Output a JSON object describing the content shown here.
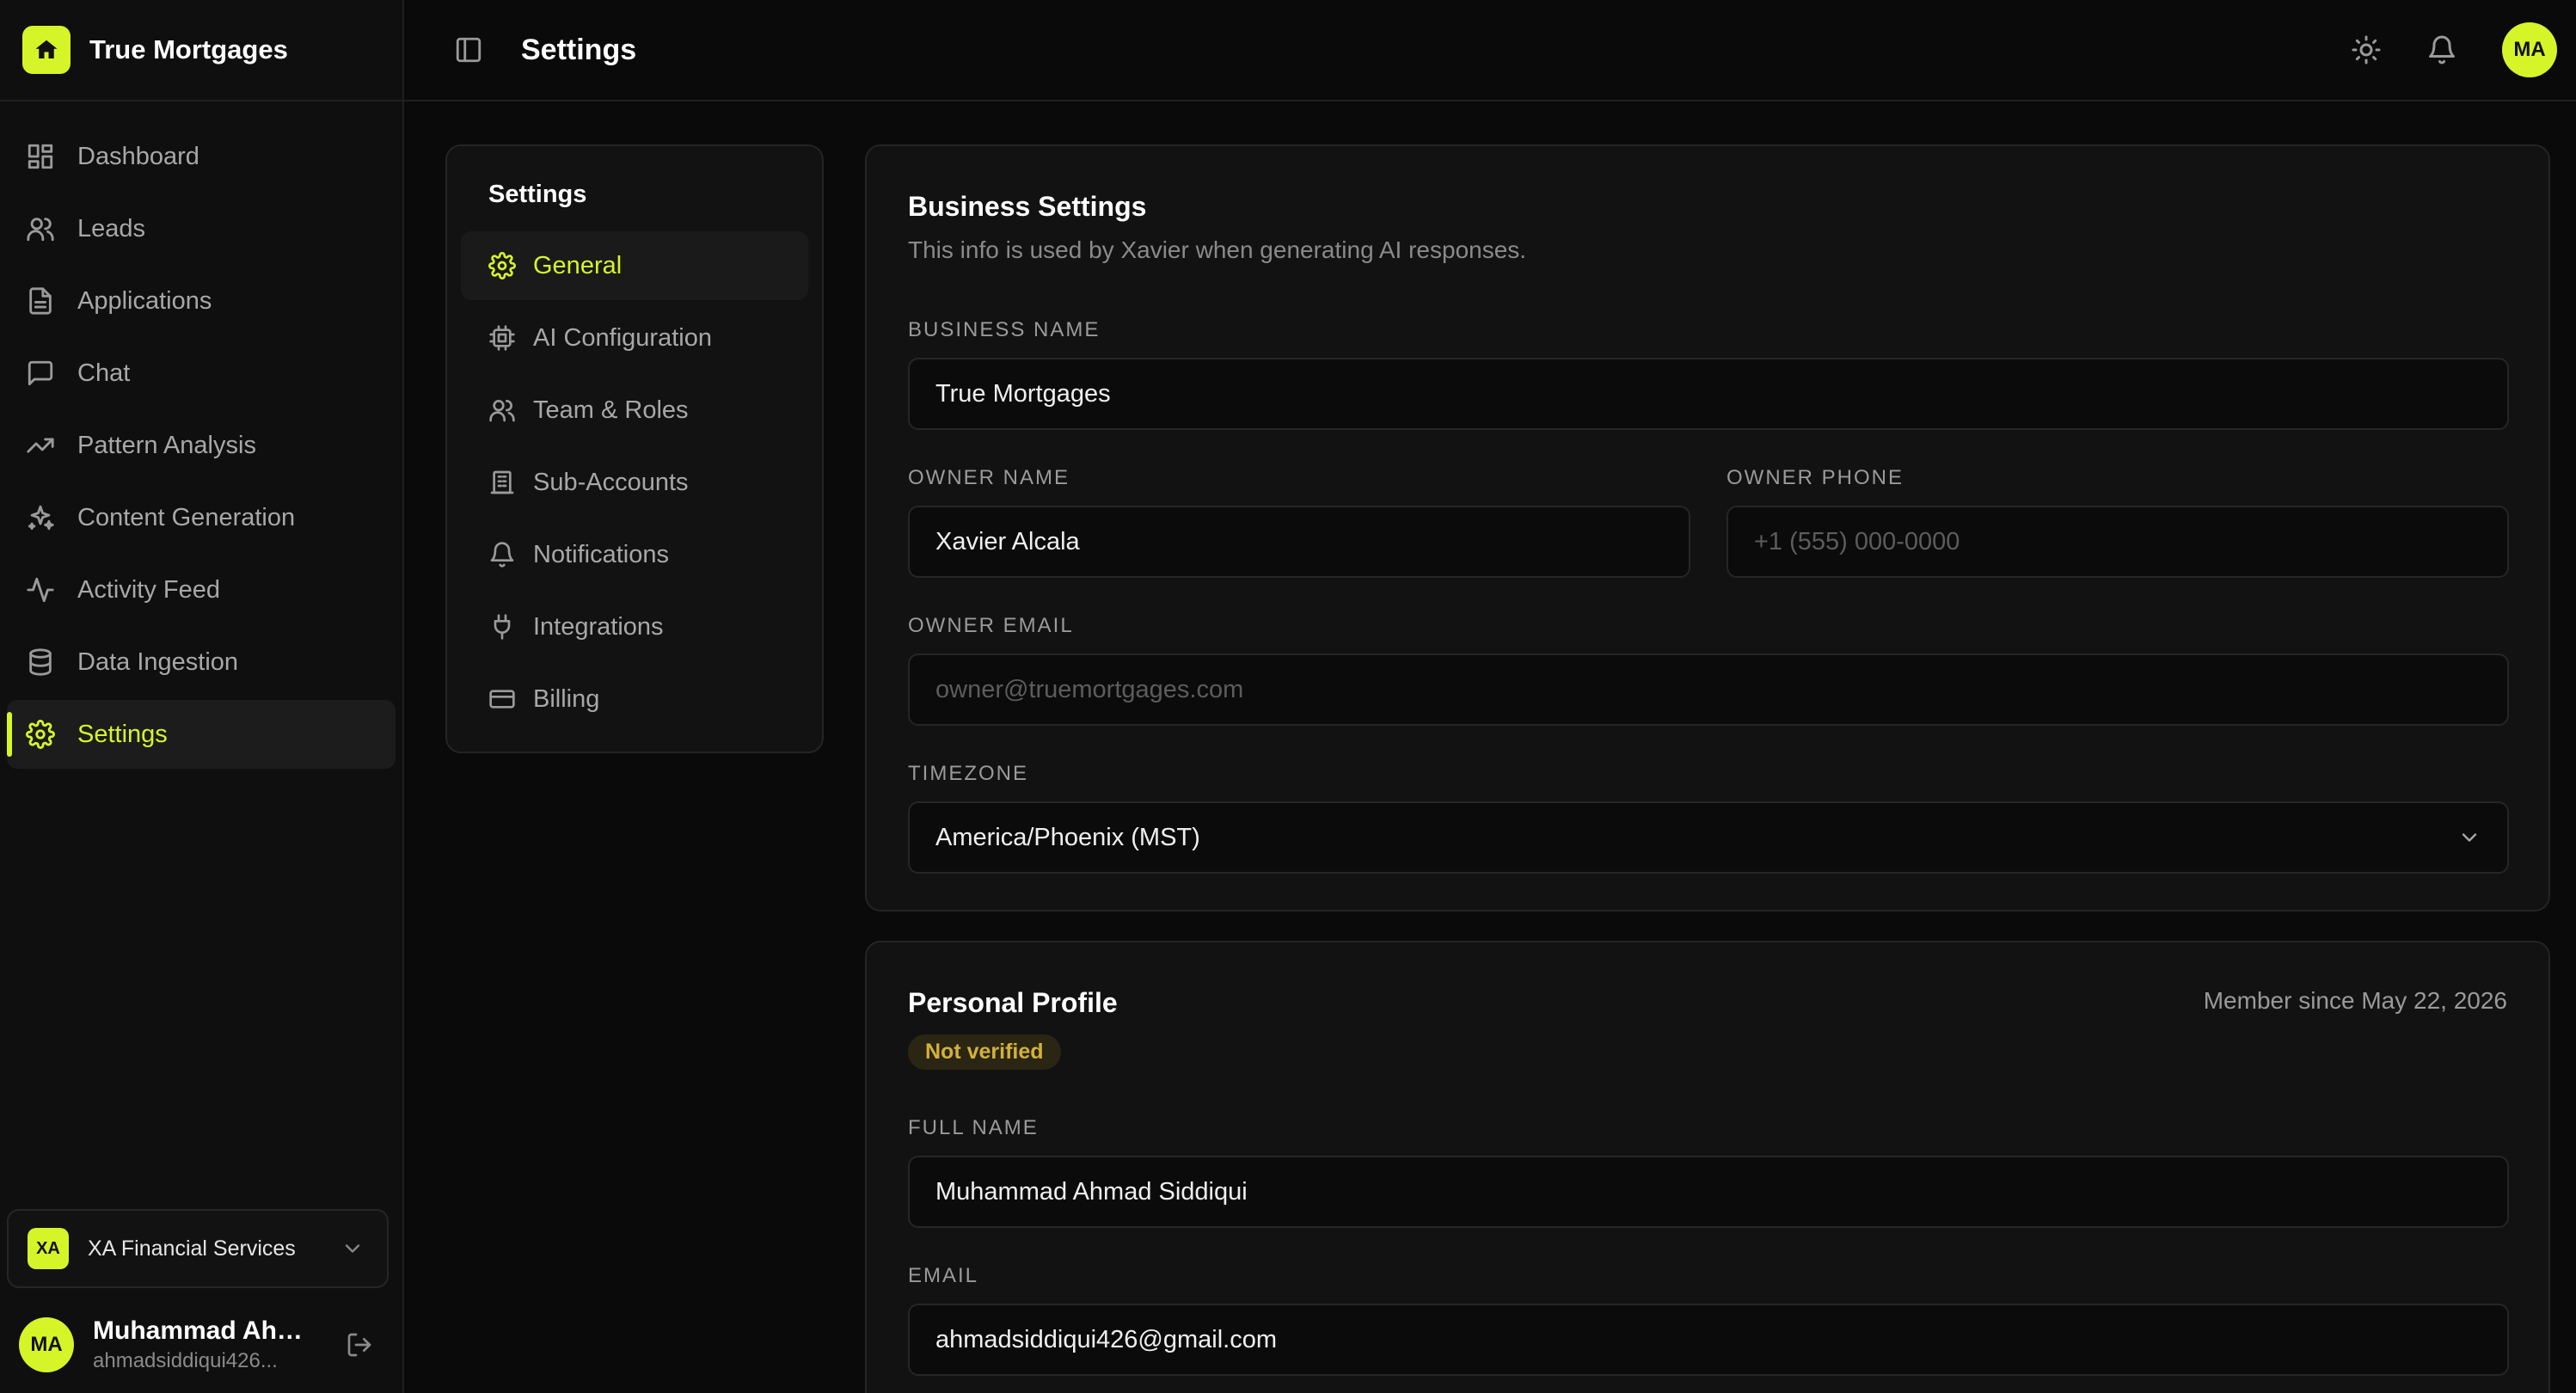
{
  "brand": {
    "name": "True Mortgages"
  },
  "nav": [
    {
      "label": "Dashboard",
      "icon": "dashboard-icon"
    },
    {
      "label": "Leads",
      "icon": "users-icon"
    },
    {
      "label": "Applications",
      "icon": "file-icon"
    },
    {
      "label": "Chat",
      "icon": "chat-icon"
    },
    {
      "label": "Pattern Analysis",
      "icon": "trending-up-icon"
    },
    {
      "label": "Content Generation",
      "icon": "sparkles-icon"
    },
    {
      "label": "Activity Feed",
      "icon": "activity-icon"
    },
    {
      "label": "Data Ingestion",
      "icon": "database-icon"
    },
    {
      "label": "Settings",
      "icon": "gear-icon",
      "active": true
    }
  ],
  "org": {
    "badge": "XA",
    "name": "XA Financial Services"
  },
  "user": {
    "initials": "MA",
    "name": "Muhammad Ahm...",
    "email": "ahmadsiddiqui426..."
  },
  "topbar": {
    "title": "Settings",
    "avatar_initials": "MA"
  },
  "settings_menu": {
    "title": "Settings",
    "items": [
      {
        "label": "General",
        "icon": "gear-icon",
        "active": true
      },
      {
        "label": "AI Configuration",
        "icon": "cpu-icon"
      },
      {
        "label": "Team & Roles",
        "icon": "users-icon"
      },
      {
        "label": "Sub-Accounts",
        "icon": "building-icon"
      },
      {
        "label": "Notifications",
        "icon": "bell-icon"
      },
      {
        "label": "Integrations",
        "icon": "plug-icon"
      },
      {
        "label": "Billing",
        "icon": "credit-card-icon"
      }
    ]
  },
  "business": {
    "title": "Business Settings",
    "subtitle": "This info is used by Xavier when generating AI responses.",
    "business_name": {
      "label": "BUSINESS NAME",
      "value": "True Mortgages"
    },
    "owner_name": {
      "label": "OWNER NAME",
      "value": "Xavier Alcala"
    },
    "owner_phone": {
      "label": "OWNER PHONE",
      "placeholder": "+1 (555) 000-0000"
    },
    "owner_email": {
      "label": "OWNER EMAIL",
      "placeholder": "owner@truemortgages.com"
    },
    "timezone": {
      "label": "TIMEZONE",
      "value": "America/Phoenix (MST)"
    }
  },
  "profile": {
    "title": "Personal Profile",
    "member_since": "Member since May 22, 2026",
    "status": "Not verified",
    "full_name": {
      "label": "FULL NAME",
      "value": "Muhammad Ahmad Siddiqui"
    },
    "email": {
      "label": "EMAIL",
      "value": "ahmadsiddiqui426@gmail.com"
    }
  },
  "colors": {
    "accent": "#d6f529",
    "background": "#0a0a0a",
    "card": "#121212",
    "warning": "#d4b13a"
  }
}
